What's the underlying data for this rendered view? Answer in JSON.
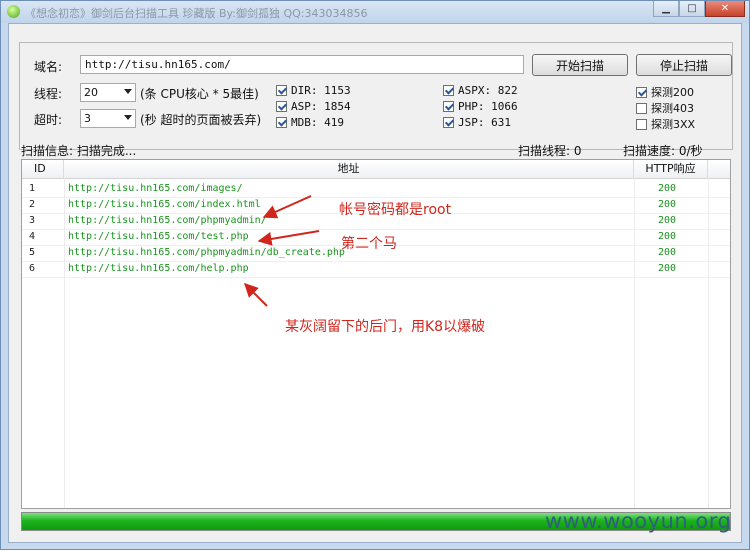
{
  "window": {
    "title": "《想念初恋》御剑后台扫描工具 珍藏版 By:御剑孤独 QQ:343034856",
    "minimize": "▁",
    "maximize": "□",
    "close": "✕"
  },
  "form": {
    "domain_label": "域名:",
    "domain_value": "http://tisu.hn165.com/",
    "threads_label": "线程:",
    "threads_value": "20",
    "threads_hint": "(条 CPU核心 * 5最佳)",
    "timeout_label": "超时:",
    "timeout_value": "3",
    "timeout_hint": "(秒 超时的页面被丢弃)",
    "start_button": "开始扫描",
    "stop_button": "停止扫描"
  },
  "dicts": [
    {
      "label": "DIR: 1153",
      "checked": true
    },
    {
      "label": "ASP: 1854",
      "checked": true
    },
    {
      "label": "MDB: 419",
      "checked": true
    },
    {
      "label": "ASPX: 822",
      "checked": true
    },
    {
      "label": "PHP: 1066",
      "checked": true
    },
    {
      "label": "JSP: 631",
      "checked": true
    }
  ],
  "probes": [
    {
      "label": "探测200",
      "checked": true
    },
    {
      "label": "探测403",
      "checked": false
    },
    {
      "label": "探测3XX",
      "checked": false
    }
  ],
  "status": {
    "info": "扫描信息: 扫描完成...",
    "threads": "扫描线程: 0",
    "speed": "扫描速度: 0/秒"
  },
  "table": {
    "columns": [
      "ID",
      "地址",
      "HTTP响应"
    ],
    "rows": [
      {
        "id": "1",
        "url": "http://tisu.hn165.com/images/",
        "code": "200"
      },
      {
        "id": "2",
        "url": "http://tisu.hn165.com/index.html",
        "code": "200"
      },
      {
        "id": "3",
        "url": "http://tisu.hn165.com/phpmyadmin/",
        "code": "200"
      },
      {
        "id": "4",
        "url": "http://tisu.hn165.com/test.php",
        "code": "200"
      },
      {
        "id": "5",
        "url": "http://tisu.hn165.com/phpmyadmin/db_create.php",
        "code": "200"
      },
      {
        "id": "6",
        "url": "http://tisu.hn165.com/help.php",
        "code": "200"
      }
    ]
  },
  "progress": 1.0,
  "annotations": {
    "a1": "帐号密码都是root",
    "a2": "第二个马",
    "a3": "某灰阔留下的后门，用K8以爆破"
  },
  "watermark": "www.wooyun.org",
  "colors": {
    "link_green": "#18941b",
    "annotation_red": "#d0261c",
    "progress_green": "#1db31d"
  }
}
